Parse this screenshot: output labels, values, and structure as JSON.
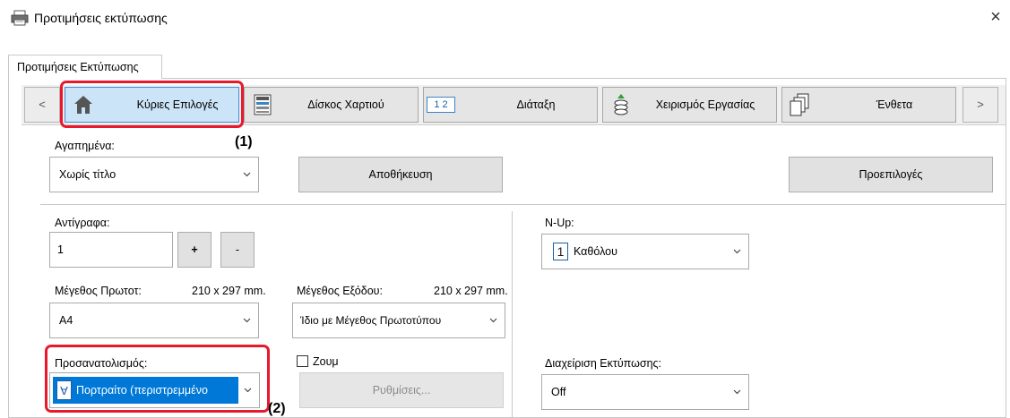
{
  "window": {
    "title": "Προτιμήσεις εκτύπωσης",
    "close_glyph": "×"
  },
  "tabs": [
    {
      "label": "Προτιμήσεις Εκτύπωσης"
    }
  ],
  "toolbar": {
    "prev": "<",
    "next": ">",
    "buttons": [
      {
        "label": "Κύριες Επιλογές",
        "icon": "home-icon"
      },
      {
        "label": "Δίσκος Χαρτιού",
        "icon": "paper-tray-icon"
      },
      {
        "label": "Διάταξη",
        "icon": "layout-icon",
        "icon_text": "1 2"
      },
      {
        "label": "Χειρισμός Εργασίας",
        "icon": "job-handling-icon"
      },
      {
        "label": "Ένθετα",
        "icon": "inserts-icon"
      }
    ]
  },
  "favorites": {
    "label": "Αγαπημένα:",
    "value": "Χωρίς τίτλο",
    "save_label": "Αποθήκευση",
    "defaults_label": "Προεπιλογές"
  },
  "copies": {
    "label": "Αντίγραφα:",
    "value": "1",
    "plus": "+",
    "minus": "-"
  },
  "nup": {
    "label": "N-Up:",
    "icon_text": "1",
    "value": "Καθόλου"
  },
  "original_size": {
    "label": "Μέγεθος Πρωτοτ:",
    "dims": "210 x 297 mm.",
    "value": "A4"
  },
  "output_size": {
    "label": "Μέγεθος Εξόδου:",
    "dims": "210 x 297 mm.",
    "value": "Ίδιο με Μέγεθος Πρωτοτύπου"
  },
  "orientation": {
    "label": "Προσανατολισμός:",
    "value": "Πορτραίτο (περιστρεμμένο",
    "icon_text": "A"
  },
  "zoom": {
    "label": "Ζουμ",
    "checked": false,
    "settings_label": "Ρυθμίσεις..."
  },
  "print_management": {
    "label": "Διαχείριση Εκτύπωσης:",
    "value": "Off"
  },
  "callouts": {
    "one": "(1)",
    "two": "(2)"
  },
  "colors": {
    "accent": "#0078d7",
    "highlight_red": "#e8192c",
    "button_gray": "#e1e1e1"
  }
}
